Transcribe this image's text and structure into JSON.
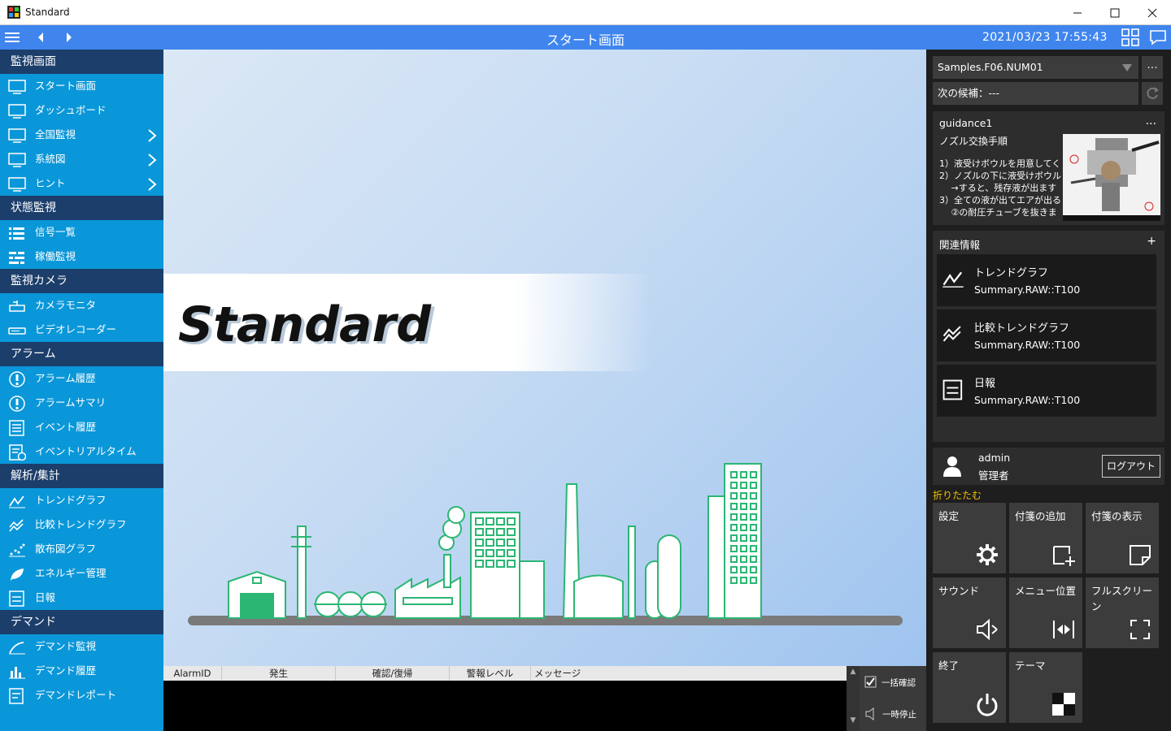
{
  "window": {
    "title": "Standard"
  },
  "topbar": {
    "screen_title": "スタート画面",
    "datetime": "2021/03/23 17:55:43"
  },
  "sidebar": {
    "sections": [
      {
        "title": "監視画面",
        "items": [
          {
            "label": "スタート画面",
            "icon": "monitor-icon",
            "chevron": false
          },
          {
            "label": "ダッシュボード",
            "icon": "monitor-icon",
            "chevron": false
          },
          {
            "label": "全国監視",
            "icon": "monitor-icon",
            "chevron": true
          },
          {
            "label": "系統図",
            "icon": "monitor-icon",
            "chevron": true
          },
          {
            "label": "ヒント",
            "icon": "monitor-icon",
            "chevron": true
          }
        ]
      },
      {
        "title": "状態監視",
        "items": [
          {
            "label": "信号一覧",
            "icon": "list-icon",
            "chevron": false
          },
          {
            "label": "稼働監視",
            "icon": "bars-icon",
            "chevron": false
          }
        ]
      },
      {
        "title": "監視カメラ",
        "items": [
          {
            "label": "カメラモニタ",
            "icon": "camera-icon",
            "chevron": false
          },
          {
            "label": "ビデオレコーダー",
            "icon": "recorder-icon",
            "chevron": false
          }
        ]
      },
      {
        "title": "アラーム",
        "items": [
          {
            "label": "アラーム履歴",
            "icon": "alarm-history-icon",
            "chevron": false
          },
          {
            "label": "アラームサマリ",
            "icon": "alarm-icon",
            "chevron": false
          },
          {
            "label": "イベント履歴",
            "icon": "event-list-icon",
            "chevron": false
          },
          {
            "label": "イベントリアルタイム",
            "icon": "event-realtime-icon",
            "chevron": false
          }
        ]
      },
      {
        "title": "解析/集計",
        "items": [
          {
            "label": "トレンドグラフ",
            "icon": "trend-icon",
            "chevron": false
          },
          {
            "label": "比較トレンドグラフ",
            "icon": "compare-trend-icon",
            "chevron": false
          },
          {
            "label": "散布図グラフ",
            "icon": "scatter-icon",
            "chevron": false
          },
          {
            "label": "エネルギー管理",
            "icon": "leaf-icon",
            "chevron": false
          },
          {
            "label": "日報",
            "icon": "report-icon",
            "chevron": false
          }
        ]
      },
      {
        "title": "デマンド",
        "items": [
          {
            "label": "デマンド監視",
            "icon": "demand-monitor-icon",
            "chevron": false
          },
          {
            "label": "デマンド履歴",
            "icon": "demand-history-icon",
            "chevron": false
          },
          {
            "label": "デマンドレポート",
            "icon": "demand-report-icon",
            "chevron": false
          }
        ]
      }
    ]
  },
  "main": {
    "banner_text": "Standard"
  },
  "alarm": {
    "columns": [
      "AlarmID",
      "発生",
      "確認/復帰",
      "警報レベル",
      "メッセージ"
    ],
    "ack_all_label": "一括確認",
    "pause_label": "一時停止"
  },
  "right_panel": {
    "signal_select": "Samples.F06.NUM01",
    "more_label": "...",
    "next_candidate": "次の候補：---",
    "guidance": {
      "title": "guidance1",
      "more_label": "...",
      "heading": "ノズル交換手順",
      "lines": [
        "1）液受けボウルを用意してく",
        "2）ノズルの下に液受けボウル",
        "　 →すると、残存液が出ます",
        "3）全ての液が出てエアが出る",
        "　 ②の耐圧チューブを抜きま"
      ]
    },
    "related": {
      "title": "関連情報",
      "add_label": "+",
      "items": [
        {
          "title": "トレンドグラフ",
          "subtitle": "Summary.RAW::T100",
          "icon": "trend-icon"
        },
        {
          "title": "比較トレンドグラフ",
          "subtitle": "Summary.RAW::T100",
          "icon": "compare-trend-icon"
        },
        {
          "title": "日報",
          "subtitle": "Summary.RAW::T100",
          "icon": "report-icon"
        }
      ]
    },
    "user": {
      "name": "admin",
      "role": "管理者",
      "logout_label": "ログアウト"
    },
    "collapse_label": "折りたたむ",
    "tiles": [
      {
        "label": "設定",
        "icon": "gear-icon"
      },
      {
        "label": "付箋の追加",
        "icon": "add-note-icon"
      },
      {
        "label": "付箋の表示",
        "icon": "note-icon"
      },
      {
        "label": "サウンド",
        "icon": "speaker-icon"
      },
      {
        "label": "メニュー位置",
        "icon": "menu-position-icon"
      },
      {
        "label": "フルスクリーン",
        "icon": "fullscreen-icon"
      },
      {
        "label": "終了",
        "icon": "power-icon"
      },
      {
        "label": "テーマ",
        "icon": "theme-icon"
      }
    ]
  },
  "colors": {
    "accent": "#3f85ed",
    "sidebar": "#0a97d9",
    "section": "#1c3e6b",
    "plant": "#2bb673",
    "collapse": "#f0c000"
  }
}
